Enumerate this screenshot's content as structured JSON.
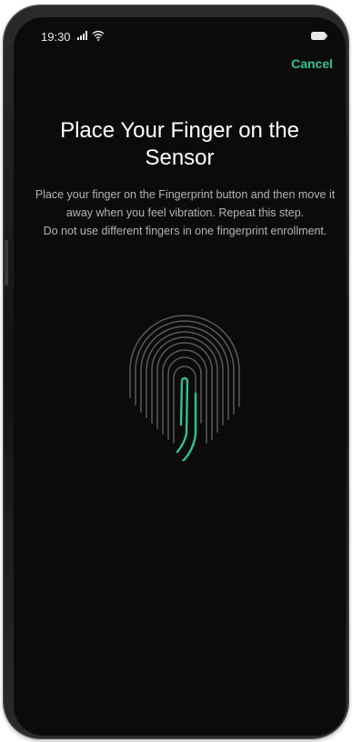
{
  "status_bar": {
    "time": "19:30",
    "icons": [
      "signal-icon",
      "wifi-icon",
      "battery-icon"
    ]
  },
  "header": {
    "cancel_label": "Cancel"
  },
  "main": {
    "title": "Place Your Finger on the Sensor",
    "instruction_primary": "Place your finger on the Fingerprint button and then move it away when you feel vibration. Repeat this step.",
    "instruction_secondary": "Do not use different fingers in one fingerprint enrollment."
  },
  "fingerprint": {
    "icon": "fingerprint-icon"
  },
  "colors": {
    "accent": "#31c28a",
    "background": "#0b0b0b",
    "text_primary": "#ffffff",
    "text_secondary": "#b4b4b4",
    "ridge_color": "#5a5a5a"
  }
}
